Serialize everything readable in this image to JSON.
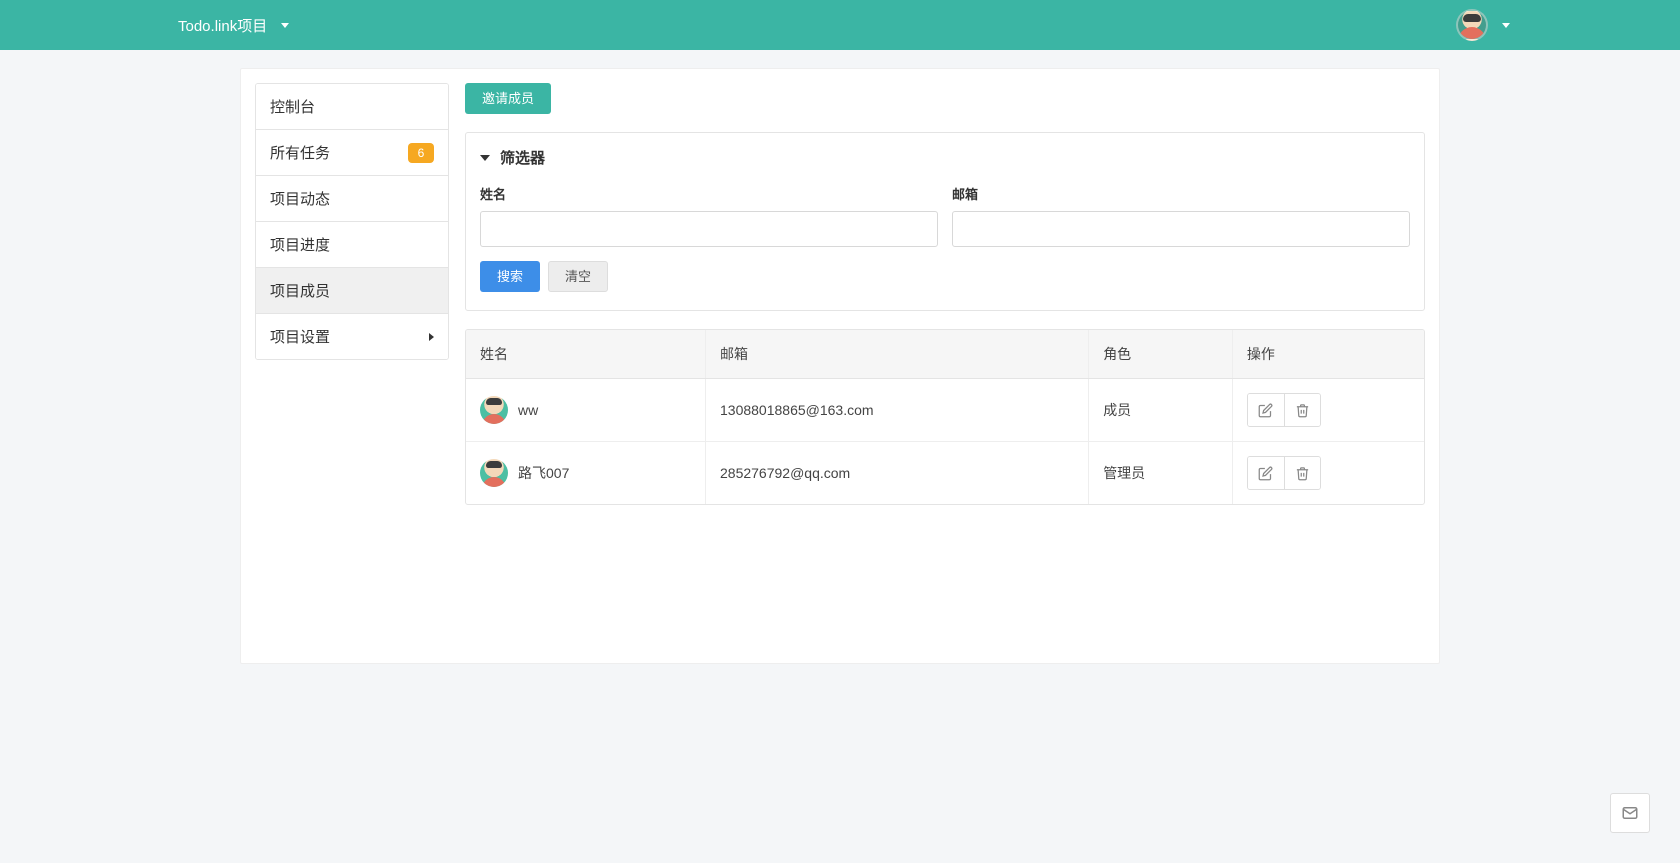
{
  "header": {
    "project_name": "Todo.link项目"
  },
  "sidebar": {
    "items": [
      {
        "label": "控制台"
      },
      {
        "label": "所有任务",
        "badge": "6"
      },
      {
        "label": "项目动态"
      },
      {
        "label": "项目进度"
      },
      {
        "label": "项目成员"
      },
      {
        "label": "项目设置"
      }
    ]
  },
  "actions": {
    "invite": "邀请成员"
  },
  "filter": {
    "title": "筛选器",
    "name_label": "姓名",
    "email_label": "邮箱",
    "name_value": "",
    "email_value": "",
    "search": "搜索",
    "clear": "清空"
  },
  "table": {
    "headers": {
      "name": "姓名",
      "email": "邮箱",
      "role": "角色",
      "actions": "操作"
    },
    "rows": [
      {
        "name": "ww",
        "email": "13088018865@163.com",
        "role": "成员"
      },
      {
        "name": "路飞007",
        "email": "285276792@qq.com",
        "role": "管理员"
      }
    ]
  }
}
